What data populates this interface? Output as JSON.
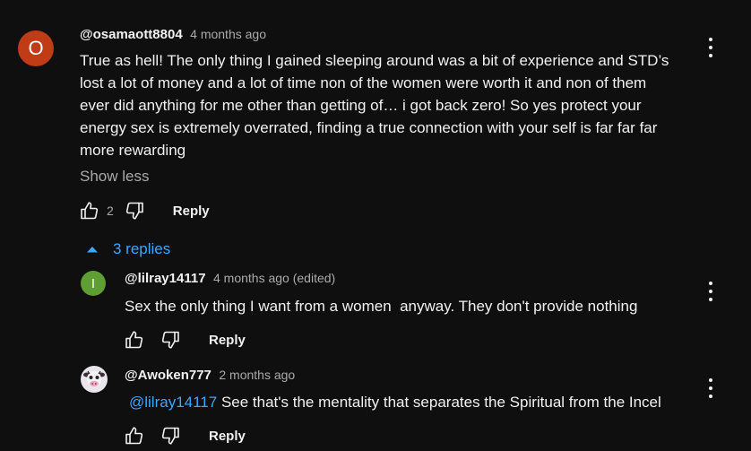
{
  "comment": {
    "avatar_letter": "O",
    "avatar_color": "#c03c17",
    "author": "@osamaott8804",
    "time": "4 months ago",
    "lines": [
      "True as hell! The only thing I gained sleeping around was a bit of experience and STD’s",
      "lost a lot of money and a lot of time non of the women were worth it and non of them",
      "ever did anything for me other than getting of… i got back zero! So yes protect your",
      "energy sex is extremely overrated, finding a true connection with your self is far far far",
      "more rewarding"
    ],
    "show_less": "Show less",
    "likes": "2",
    "reply_label": "Reply"
  },
  "replies_toggle": {
    "label": "3 replies",
    "icon": "chevron-up-icon"
  },
  "replies": [
    {
      "avatar_letter": "I",
      "avatar_color": "#5e9e33",
      "author": "@lilray14117",
      "time": "4 months ago (edited)",
      "text": "Sex the only thing I want from a women  anyway. They don't provide nothing",
      "reply_label": "Reply"
    },
    {
      "avatar_icon": "cow-avatar-icon",
      "author": "@Awoken777",
      "time": "2 months ago",
      "mention": "@lilray14117",
      "text": " See that's the mentality that separates the Spiritual from the Incel",
      "reply_label": "Reply"
    }
  ],
  "colors": {
    "background": "#0f0f0f",
    "text": "#f1f1f1",
    "secondary": "#aaaaaa",
    "link": "#3ea6ff"
  }
}
